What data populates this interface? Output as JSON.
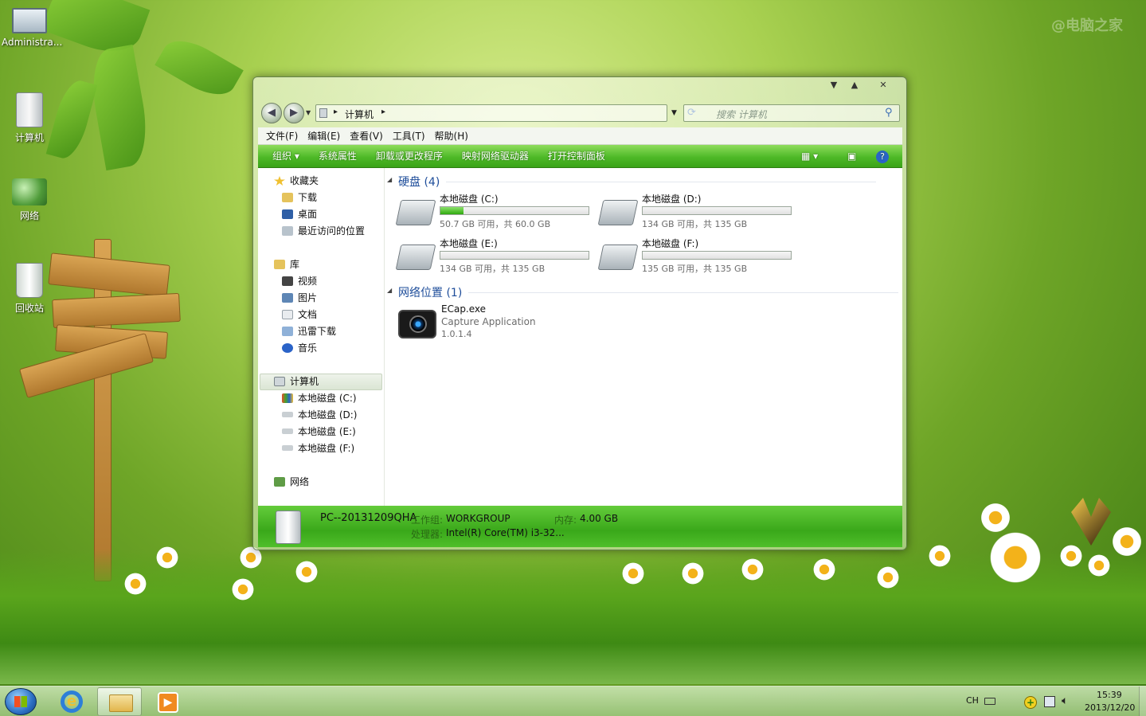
{
  "desktop": {
    "icons": [
      {
        "label": "Administra..."
      },
      {
        "label": "计算机"
      },
      {
        "label": "网络"
      },
      {
        "label": "回收站"
      }
    ]
  },
  "window": {
    "caption_buttons": {
      "minimize": "▼",
      "maximize": "▲",
      "close": "✕"
    },
    "address": {
      "segments": [
        "计算机"
      ],
      "separator": "▸"
    },
    "search_placeholder": "搜索 计算机",
    "menu": [
      "文件(F)",
      "编辑(E)",
      "查看(V)",
      "工具(T)",
      "帮助(H)"
    ],
    "commands": [
      "组织 ▾",
      "系统属性",
      "卸载或更改程序",
      "映射网络驱动器",
      "打开控制面板"
    ],
    "nav": {
      "favorites": {
        "title": "收藏夹",
        "items": [
          "下载",
          "桌面",
          "最近访问的位置"
        ]
      },
      "libraries": {
        "title": "库",
        "items": [
          "视频",
          "图片",
          "文档",
          "迅雷下载",
          "音乐"
        ]
      },
      "computer": {
        "title": "计算机",
        "items": [
          "本地磁盘 (C:)",
          "本地磁盘 (D:)",
          "本地磁盘 (E:)",
          "本地磁盘 (F:)"
        ]
      },
      "network": {
        "title": "网络"
      }
    },
    "sections": {
      "drives_title": "硬盘 (4)",
      "network_title": "网络位置 (1)"
    },
    "drives": [
      {
        "name": "本地磁盘 (C:)",
        "space": "50.7 GB 可用，共 60.0 GB",
        "used_fraction": 0.155
      },
      {
        "name": "本地磁盘 (D:)",
        "space": "134 GB 可用，共 135 GB",
        "used_fraction": 0.0
      },
      {
        "name": "本地磁盘 (E:)",
        "space": "134 GB 可用，共 135 GB",
        "used_fraction": 0.0
      },
      {
        "name": "本地磁盘 (F:)",
        "space": "135 GB 可用，共 135 GB",
        "used_fraction": 0.0
      }
    ],
    "network_item": {
      "name": "ECap.exe",
      "desc": "Capture Application",
      "version": "1.0.1.4"
    },
    "details": {
      "pc_name": "PC--20131209QHA",
      "workgroup_label": "工作组:",
      "workgroup": "WORKGROUP",
      "memory_label": "内存:",
      "memory": "4.00 GB",
      "cpu_label": "处理器:",
      "cpu": "Intel(R) Core(TM) i3-32..."
    }
  },
  "taskbar": {
    "lang": "CH",
    "time": "15:39",
    "date": "2013/12/20"
  },
  "watermark": "@电脑之家"
}
